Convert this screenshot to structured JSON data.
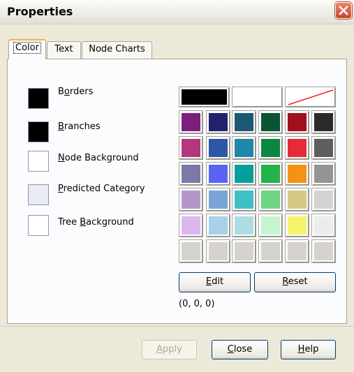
{
  "dialog": {
    "title": "Properties"
  },
  "tabs": [
    {
      "label": "Color",
      "active": true
    },
    {
      "label": "Text",
      "active": false
    },
    {
      "label": "Node Charts",
      "active": false
    }
  ],
  "color_items": [
    {
      "pre": "B",
      "ul": "o",
      "post": "rders",
      "color": "#000000"
    },
    {
      "pre": "",
      "ul": "B",
      "post": "ranches",
      "color": "#000000"
    },
    {
      "pre": "",
      "ul": "N",
      "post": "ode Background",
      "color": "#ffffff"
    },
    {
      "pre": "",
      "ul": "P",
      "post": "redicted Category",
      "color": "#ebebf3"
    },
    {
      "pre": "Tree ",
      "ul": "B",
      "post": "ackground",
      "color": "#ffffff"
    }
  ],
  "palette": {
    "top_row": [
      "#000000",
      "#ffffff",
      "none"
    ],
    "rows": [
      [
        "#7b1f7d",
        "#25206e",
        "#1d5873",
        "#0b5433",
        "#a10e1d",
        "#2a2a2a"
      ],
      [
        "#b2377c",
        "#2f57a7",
        "#1f87a8",
        "#0b8743",
        "#e52c36",
        "#5e5e5e"
      ],
      [
        "#7a79a8",
        "#5b64f2",
        "#05a09c",
        "#25b24a",
        "#f59214",
        "#949494"
      ],
      [
        "#b497c9",
        "#79a5d4",
        "#3fbfc6",
        "#6fd483",
        "#d6c884",
        "#d3d3d3"
      ],
      [
        "#dcb7ef",
        "#a8d0e8",
        "#addde2",
        "#c5f4ce",
        "#f4f46c",
        "#ececec"
      ],
      [
        "#d5d3cb",
        "#d5d3cb",
        "#d5d3cb",
        "#d5d3cb",
        "#d5d3cb",
        "#d5d3cb"
      ]
    ]
  },
  "buttons": {
    "edit": {
      "ul": "E",
      "post": "dit"
    },
    "reset": {
      "ul": "R",
      "post": "eset"
    },
    "apply": {
      "ul": "A",
      "post": "pply"
    },
    "close": {
      "ul": "C",
      "post": "lose"
    },
    "help": {
      "ul": "H",
      "post": "elp"
    }
  },
  "rgb_readout": "(0, 0, 0)",
  "icons": {
    "close": "close-x-icon",
    "none_swatch": "diagonal-line-icon"
  }
}
